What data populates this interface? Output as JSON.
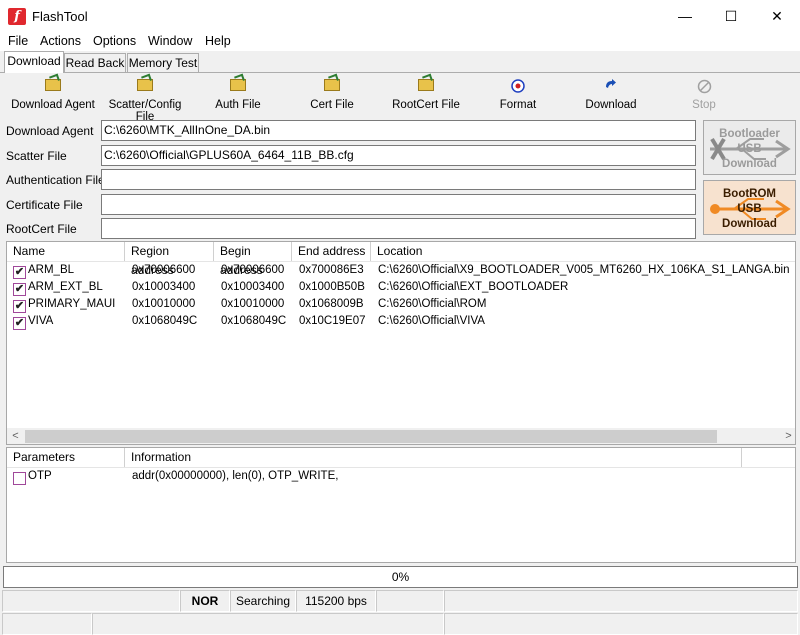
{
  "window": {
    "title": "FlashTool",
    "icon_letter": "f",
    "minimize": "—",
    "maximize": "☐",
    "close": "✕"
  },
  "menu": [
    "File",
    "Actions",
    "Options",
    "Window",
    "Help"
  ],
  "tabs": [
    "Download",
    "Read Back",
    "Memory Test"
  ],
  "toolbar": [
    {
      "label": "Download Agent",
      "icon": "folder-open-icon"
    },
    {
      "label": "Scatter/Config File",
      "icon": "folder-open-icon"
    },
    {
      "label": "Auth File",
      "icon": "folder-open-icon"
    },
    {
      "label": "Cert File",
      "icon": "folder-open-icon"
    },
    {
      "label": "RootCert File",
      "icon": "folder-open-icon"
    },
    {
      "label": "Format",
      "icon": "format-icon"
    },
    {
      "label": "Download",
      "icon": "download-icon"
    },
    {
      "label": "Stop",
      "icon": "stop-icon",
      "disabled": true
    }
  ],
  "fields": [
    {
      "label": "Download Agent",
      "value": "C:\\6260\\MTK_AllInOne_DA.bin"
    },
    {
      "label": "Scatter File",
      "value": "C:\\6260\\Official\\GPLUS60A_6464_11B_BB.cfg"
    },
    {
      "label": "Authentication File",
      "value": ""
    },
    {
      "label": "Certificate File",
      "value": ""
    },
    {
      "label": "RootCert File",
      "value": ""
    }
  ],
  "side_buttons": {
    "bootloader": [
      "Bootloader",
      "USB",
      "Download"
    ],
    "bootrom": [
      "BootROM",
      "USB",
      "Download"
    ]
  },
  "table": {
    "columns": [
      "Name",
      "Region address",
      "Begin address",
      "End address",
      "Location"
    ],
    "rows": [
      {
        "checked": true,
        "name": "ARM_BL",
        "region": "0x70006600",
        "begin": "0x70006600",
        "end": "0x700086E3",
        "location": "C:\\6260\\Official\\X9_BOOTLOADER_V005_MT6260_HX_106KA_S1_LANGA.bin"
      },
      {
        "checked": true,
        "name": "ARM_EXT_BL",
        "region": "0x10003400",
        "begin": "0x10003400",
        "end": "0x1000B50B",
        "location": "C:\\6260\\Official\\EXT_BOOTLOADER"
      },
      {
        "checked": true,
        "name": "PRIMARY_MAUI",
        "region": "0x10010000",
        "begin": "0x10010000",
        "end": "0x1068009B",
        "location": "C:\\6260\\Official\\ROM"
      },
      {
        "checked": true,
        "name": "VIVA",
        "region": "0x1068049C",
        "begin": "0x1068049C",
        "end": "0x10C19E07",
        "location": "C:\\6260\\Official\\VIVA"
      }
    ]
  },
  "params": {
    "columns": [
      "Parameters",
      "Information"
    ],
    "rows": [
      {
        "checked": false,
        "name": "OTP",
        "info": "addr(0x00000000), len(0), OTP_WRITE,"
      }
    ]
  },
  "progress": {
    "text": "0%",
    "value": 0
  },
  "status": {
    "flash_type": "NOR",
    "state": "Searching",
    "baud": "115200 bps"
  },
  "colors": {
    "bootrom_bg": "#f7e2cf",
    "bootrom_arrow": "#f08a24",
    "bootloader_arrow": "#9e9e9e",
    "checkbox_border": "#a0489a"
  }
}
